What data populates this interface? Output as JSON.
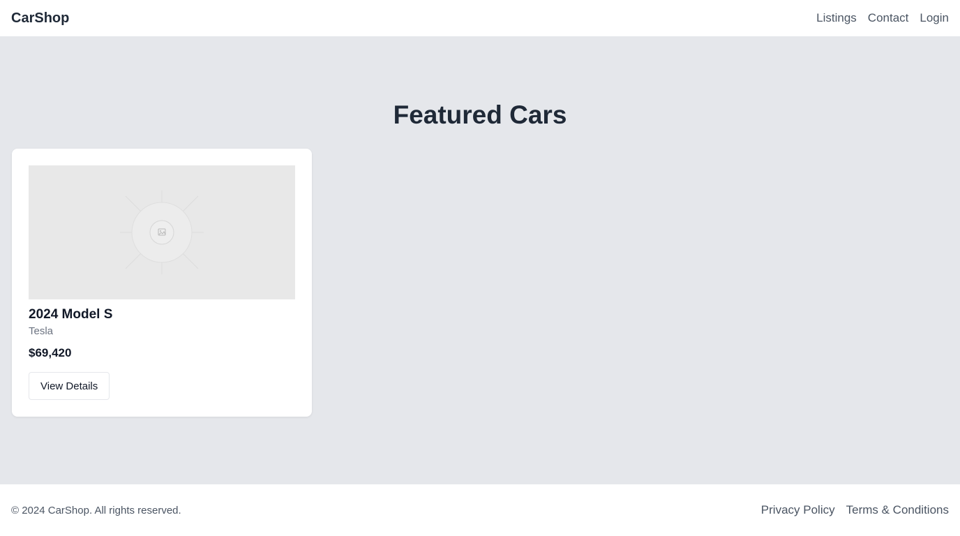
{
  "header": {
    "brand": "CarShop",
    "nav": [
      "Listings",
      "Contact",
      "Login"
    ]
  },
  "main": {
    "title": "Featured Cars",
    "cards": [
      {
        "image_icon": "image-placeholder-icon",
        "title": "2024 Model S",
        "make": "Tesla",
        "price": "$69,420",
        "button_label": "View Details"
      }
    ]
  },
  "footer": {
    "copyright": "© 2024 CarShop. All rights reserved.",
    "links": [
      "Privacy Policy",
      "Terms & Conditions"
    ]
  },
  "colors": {
    "page_bg": "#e5e7eb",
    "surface": "#ffffff",
    "text_dark": "#1f2937",
    "text_muted": "#4b5563",
    "placeholder_bg": "#e8e8e8"
  }
}
